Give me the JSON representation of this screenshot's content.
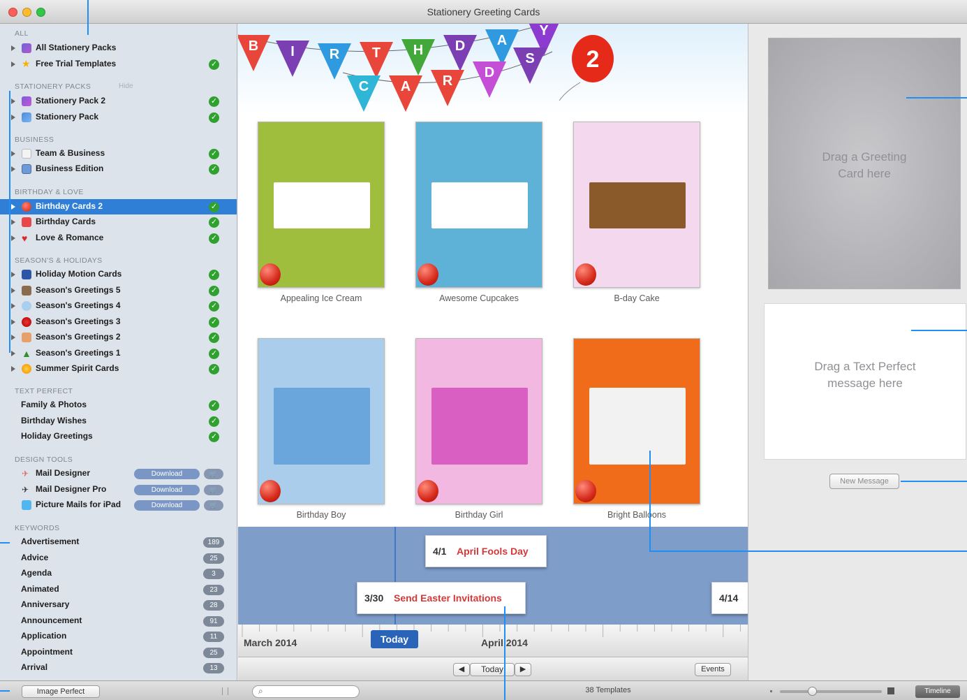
{
  "window": {
    "title": "Stationery Greeting Cards"
  },
  "sidebar": {
    "sections": {
      "all": "ALL",
      "stationery": "STATIONERY PACKS",
      "stationery_hide": "Hide",
      "business": "BUSINESS",
      "birthday": "BIRTHDAY & LOVE",
      "seasons": "SEASON'S & HOLIDAYS",
      "textperfect": "TEXT PERFECT",
      "design": "DESIGN TOOLS",
      "keywords": "KEYWORDS"
    },
    "all_items": [
      {
        "label": "All Stationery Packs",
        "installed": false
      },
      {
        "label": "Free Trial Templates",
        "installed": true
      }
    ],
    "stationery_items": [
      {
        "label": "Stationery Pack 2",
        "installed": true
      },
      {
        "label": "Stationery Pack",
        "installed": true
      }
    ],
    "business_items": [
      {
        "label": "Team & Business",
        "installed": true
      },
      {
        "label": "Business Edition",
        "installed": true
      }
    ],
    "birthday_items": [
      {
        "label": "Birthday Cards 2",
        "installed": true,
        "selected": true
      },
      {
        "label": "Birthday Cards",
        "installed": true
      },
      {
        "label": "Love & Romance",
        "installed": true
      }
    ],
    "season_items": [
      {
        "label": "Holiday Motion Cards",
        "installed": true
      },
      {
        "label": "Season's Greetings 5",
        "installed": true
      },
      {
        "label": "Season's Greetings 4",
        "installed": true
      },
      {
        "label": "Season's Greetings 3",
        "installed": true
      },
      {
        "label": "Season's Greetings 2",
        "installed": true
      },
      {
        "label": "Season's Greetings 1",
        "installed": true
      },
      {
        "label": "Summer Spirit Cards",
        "installed": true
      }
    ],
    "textperfect_items": [
      {
        "label": "Family & Photos",
        "installed": true
      },
      {
        "label": "Birthday Wishes",
        "installed": true
      },
      {
        "label": "Holiday Greetings",
        "installed": true
      }
    ],
    "design_items": [
      {
        "label": "Mail Designer",
        "button": "Download"
      },
      {
        "label": "Mail Designer Pro",
        "button": "Download"
      },
      {
        "label": "Picture Mails for iPad",
        "button": "Download"
      }
    ],
    "keywords": [
      {
        "label": "Advertisement",
        "count": "189"
      },
      {
        "label": "Advice",
        "count": "25"
      },
      {
        "label": "Agenda",
        "count": "3"
      },
      {
        "label": "Animated",
        "count": "23"
      },
      {
        "label": "Anniversary",
        "count": "28"
      },
      {
        "label": "Announcement",
        "count": "91"
      },
      {
        "label": "Application",
        "count": "11"
      },
      {
        "label": "Appointment",
        "count": "25"
      },
      {
        "label": "Arrival",
        "count": "13"
      }
    ],
    "bottom_button": "Image Perfect"
  },
  "banner": {
    "letters": [
      "B",
      "I",
      "R",
      "T",
      "H",
      "D",
      "A",
      "Y",
      "C",
      "A",
      "R",
      "D",
      "S"
    ],
    "balloon_number": "2"
  },
  "cards": [
    {
      "name": "Appealing Ice Cream",
      "bg": "#9fbe3d",
      "inner": "#ffffff"
    },
    {
      "name": "Awesome Cupcakes",
      "bg": "#5fb2d7",
      "inner": "#ffffff"
    },
    {
      "name": "B-day Cake",
      "bg": "#f3d8ee",
      "inner": "#8b5a2b"
    },
    {
      "name": "Birthday Boy",
      "bg": "#a9cdeb",
      "inner": "#6aa6db"
    },
    {
      "name": "Birthday Girl",
      "bg": "#f2b8e2",
      "inner": "#d95fc3"
    },
    {
      "name": "Bright Balloons",
      "bg": "#f06b1a",
      "inner": "#f2f2f2"
    }
  ],
  "timeline": {
    "events": [
      {
        "date": "4/1",
        "name": "April Fools Day"
      },
      {
        "date": "3/30",
        "name": "Send Easter Invitations"
      },
      {
        "date": "4/14",
        "name": ""
      }
    ],
    "today_marker": "Today",
    "months": [
      "March 2014",
      "April 2014"
    ],
    "nav_today": "Today",
    "events_button": "Events"
  },
  "right": {
    "drop_card": "Drag a Greeting Card here",
    "drop_message": "Drag a Text Perfect message here",
    "new_message": "New Message"
  },
  "status": {
    "search_placeholder": "",
    "template_count": "38 Templates",
    "timeline_button": "Timeline"
  }
}
